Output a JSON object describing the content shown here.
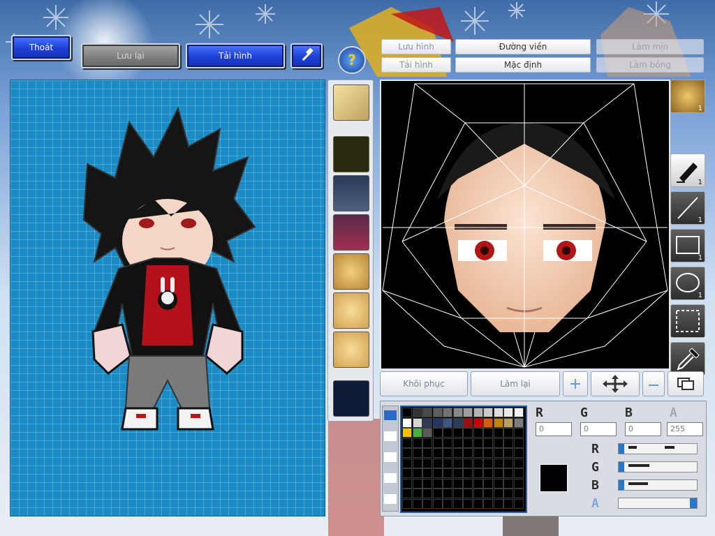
{
  "toolbar": {
    "exit_label": "Thoát",
    "save_label": "Lưu lại",
    "reload_label": "Tải hình",
    "help_symbol": "?"
  },
  "tabs": {
    "save_image": "Lưu hình",
    "outline": "Đường viền",
    "smooth": "Làm mịn",
    "load_image": "Tải hình",
    "default": "Mặc định",
    "shading": "Làm bóng"
  },
  "tools": {
    "pen_count": "1",
    "line_count": "1",
    "rect_count": "1",
    "ellipse_count": "1",
    "face_count": "1"
  },
  "actions": {
    "restore_label": "Khôi phục",
    "redo_label": "Làm lại"
  },
  "color": {
    "r_label": "R",
    "g_label": "G",
    "b_label": "B",
    "a_label": "A",
    "r_value": "0",
    "g_value": "0",
    "b_value": "0",
    "a_value": "255",
    "current": "#000000",
    "palette_row1": [
      "#000000",
      "#333333",
      "#4a4a4a",
      "#5e5e5e",
      "#727272",
      "#888888",
      "#9e9e9e",
      "#b4b4b4",
      "#cacaca",
      "#dddddd",
      "#e9e9e9",
      "#f2f2f2"
    ],
    "palette_row2": [
      "#ffffff",
      "#d5d5d5",
      "#303a55",
      "#243663",
      "#3f5684",
      "#2c3c5c",
      "#9b1010",
      "#d00000",
      "#d85a10",
      "#c48210",
      "#bba060",
      "#7d7d7d"
    ],
    "palette_row3": [
      "#f2c200",
      "#46b23b",
      "#5a5a5a"
    ]
  },
  "brand_colors": {
    "canvas_blue": "#1a8bc4",
    "button_blue": "#1d3fd6"
  }
}
